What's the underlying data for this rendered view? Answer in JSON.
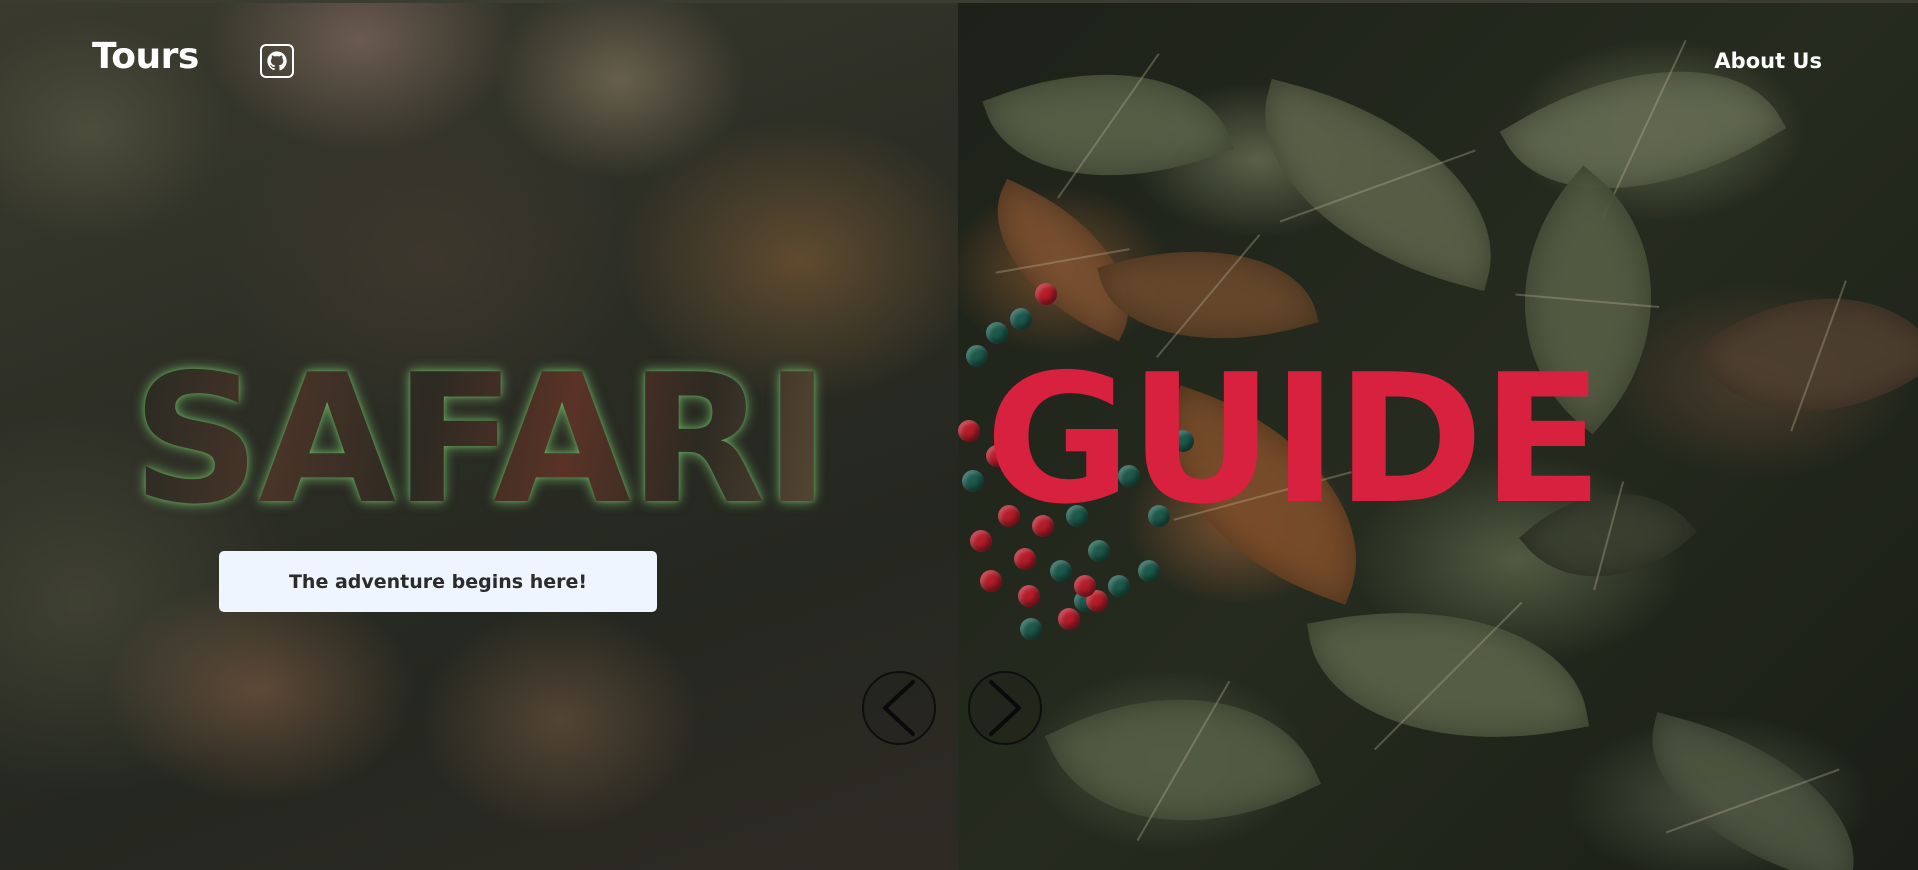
{
  "header": {
    "brand": "Tours",
    "github_icon": "github-icon",
    "about_label": "About Us"
  },
  "hero": {
    "title_left": "SAFARI",
    "title_right": "GUIDE",
    "title_right_color": "#d8213f",
    "tagline": "The adventure begins here!"
  },
  "slider": {
    "prev_icon": "chevron-left-icon",
    "next_icon": "chevron-right-icon"
  },
  "colors": {
    "button_background": "#eef5ff",
    "text_white": "#ffffff"
  }
}
